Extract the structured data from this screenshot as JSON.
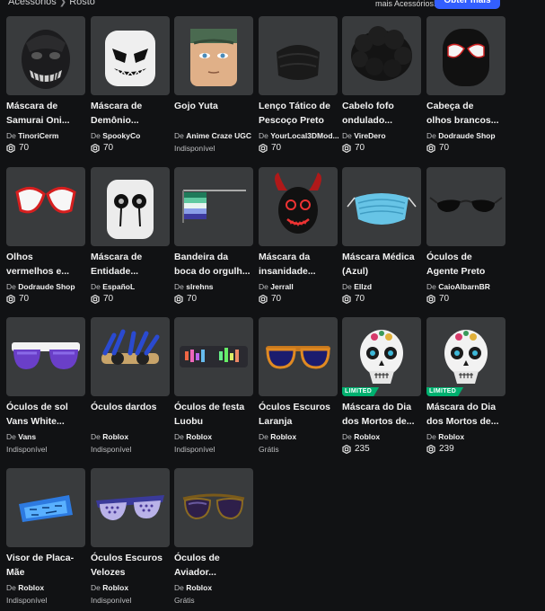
{
  "breadcrumb": {
    "first": "Acessórios",
    "second": "Rosto"
  },
  "header": {
    "more_note": "mais Acessórios!",
    "get_more_label": "Obter mais"
  },
  "labels": {
    "by": "De",
    "limited": "LIMITED"
  },
  "items": [
    {
      "name1": "Máscara de",
      "name2": "Samurai Oni...",
      "creator": "TinoriCerm",
      "price": "70",
      "status": "",
      "limited": false,
      "icon": "black-oni-mask-icon"
    },
    {
      "name1": "Máscara de",
      "name2": "Demônio...",
      "creator": "SpookyCo",
      "price": "70",
      "status": "",
      "limited": false,
      "icon": "white-demon-mask-icon"
    },
    {
      "name1": "Gojo Yuta",
      "name2": "",
      "creator": "Anime Craze UGC",
      "price": "",
      "status": "Indisponível",
      "limited": false,
      "icon": "blindfold-face-icon"
    },
    {
      "name1": "Lenço Tático de",
      "name2": "Pescoço Preto",
      "creator": "YourLocal3DMod...",
      "price": "70",
      "status": "",
      "limited": false,
      "icon": "black-neck-gaiter-icon"
    },
    {
      "name1": "Cabelo fofo",
      "name2": "ondulado...",
      "creator": "VireDero",
      "price": "70",
      "status": "",
      "limited": false,
      "icon": "wavy-black-hair-icon"
    },
    {
      "name1": "Cabeça de",
      "name2": "olhos brancos...",
      "creator": "Dodraude Shop",
      "price": "70",
      "status": "",
      "limited": false,
      "icon": "white-eyes-head-icon"
    },
    {
      "name1": "Olhos",
      "name2": "vermelhos e...",
      "creator": "Dodraude Shop",
      "price": "70",
      "status": "",
      "limited": false,
      "icon": "red-white-eyes-icon"
    },
    {
      "name1": "Máscara de",
      "name2": "Entidade...",
      "creator": "EspañoL",
      "price": "70",
      "status": "",
      "limited": false,
      "icon": "white-entity-mask-icon"
    },
    {
      "name1": "Bandeira da",
      "name2": "boca do orgulh...",
      "creator": "slrehns",
      "price": "70",
      "status": "",
      "limited": false,
      "icon": "pride-flag-mouth-icon"
    },
    {
      "name1": "Máscara da",
      "name2": "insanidade...",
      "creator": "Jerrall",
      "price": "70",
      "status": "",
      "limited": false,
      "icon": "horned-insanity-mask-icon"
    },
    {
      "name1": "Máscara Médica",
      "name2": "(Azul)",
      "creator": "Ellzd",
      "price": "70",
      "status": "",
      "limited": false,
      "icon": "blue-medical-mask-icon"
    },
    {
      "name1": "Óculos de",
      "name2": "Agente Preto",
      "creator": "CaioAlbarnBR",
      "price": "70",
      "status": "",
      "limited": false,
      "icon": "black-agent-glasses-icon"
    },
    {
      "name1": "Óculos de sol",
      "name2": "Vans White...",
      "creator": "Vans",
      "price": "",
      "status": "Indisponível",
      "limited": false,
      "icon": "white-sunglasses-icon"
    },
    {
      "name1": "Óculos dardos",
      "name2": "",
      "creator": "Roblox",
      "price": "",
      "status": "Indisponível",
      "limited": false,
      "icon": "dart-glasses-icon"
    },
    {
      "name1": "Óculos de festa",
      "name2": "Luobu",
      "creator": "Roblox",
      "price": "",
      "status": "Indisponível",
      "limited": false,
      "icon": "party-led-glasses-icon"
    },
    {
      "name1": "Óculos Escuros",
      "name2": "Laranja",
      "creator": "Roblox",
      "price": "",
      "status": "Grátis",
      "limited": false,
      "icon": "orange-sunglasses-icon"
    },
    {
      "name1": "Máscara do Dia",
      "name2": "dos Mortos de...",
      "creator": "Roblox",
      "price": "235",
      "status": "",
      "limited": true,
      "icon": "day-of-dead-mask-icon"
    },
    {
      "name1": "Máscara do Dia",
      "name2": "dos Mortos de...",
      "creator": "Roblox",
      "price": "239",
      "status": "",
      "limited": true,
      "icon": "day-of-dead-mask-icon"
    },
    {
      "name1": "Visor de Placa-",
      "name2": "Mãe",
      "creator": "Roblox",
      "price": "",
      "status": "Indisponível",
      "limited": false,
      "icon": "motherboard-visor-icon"
    },
    {
      "name1": "Óculos Escuros",
      "name2": "Velozes",
      "creator": "Roblox",
      "price": "",
      "status": "Indisponível",
      "limited": false,
      "icon": "speedy-sunglasses-icon"
    },
    {
      "name1": "Óculos de",
      "name2": "Aviador...",
      "creator": "Roblox",
      "price": "",
      "status": "Grátis",
      "limited": false,
      "icon": "aviator-glasses-icon"
    }
  ]
}
